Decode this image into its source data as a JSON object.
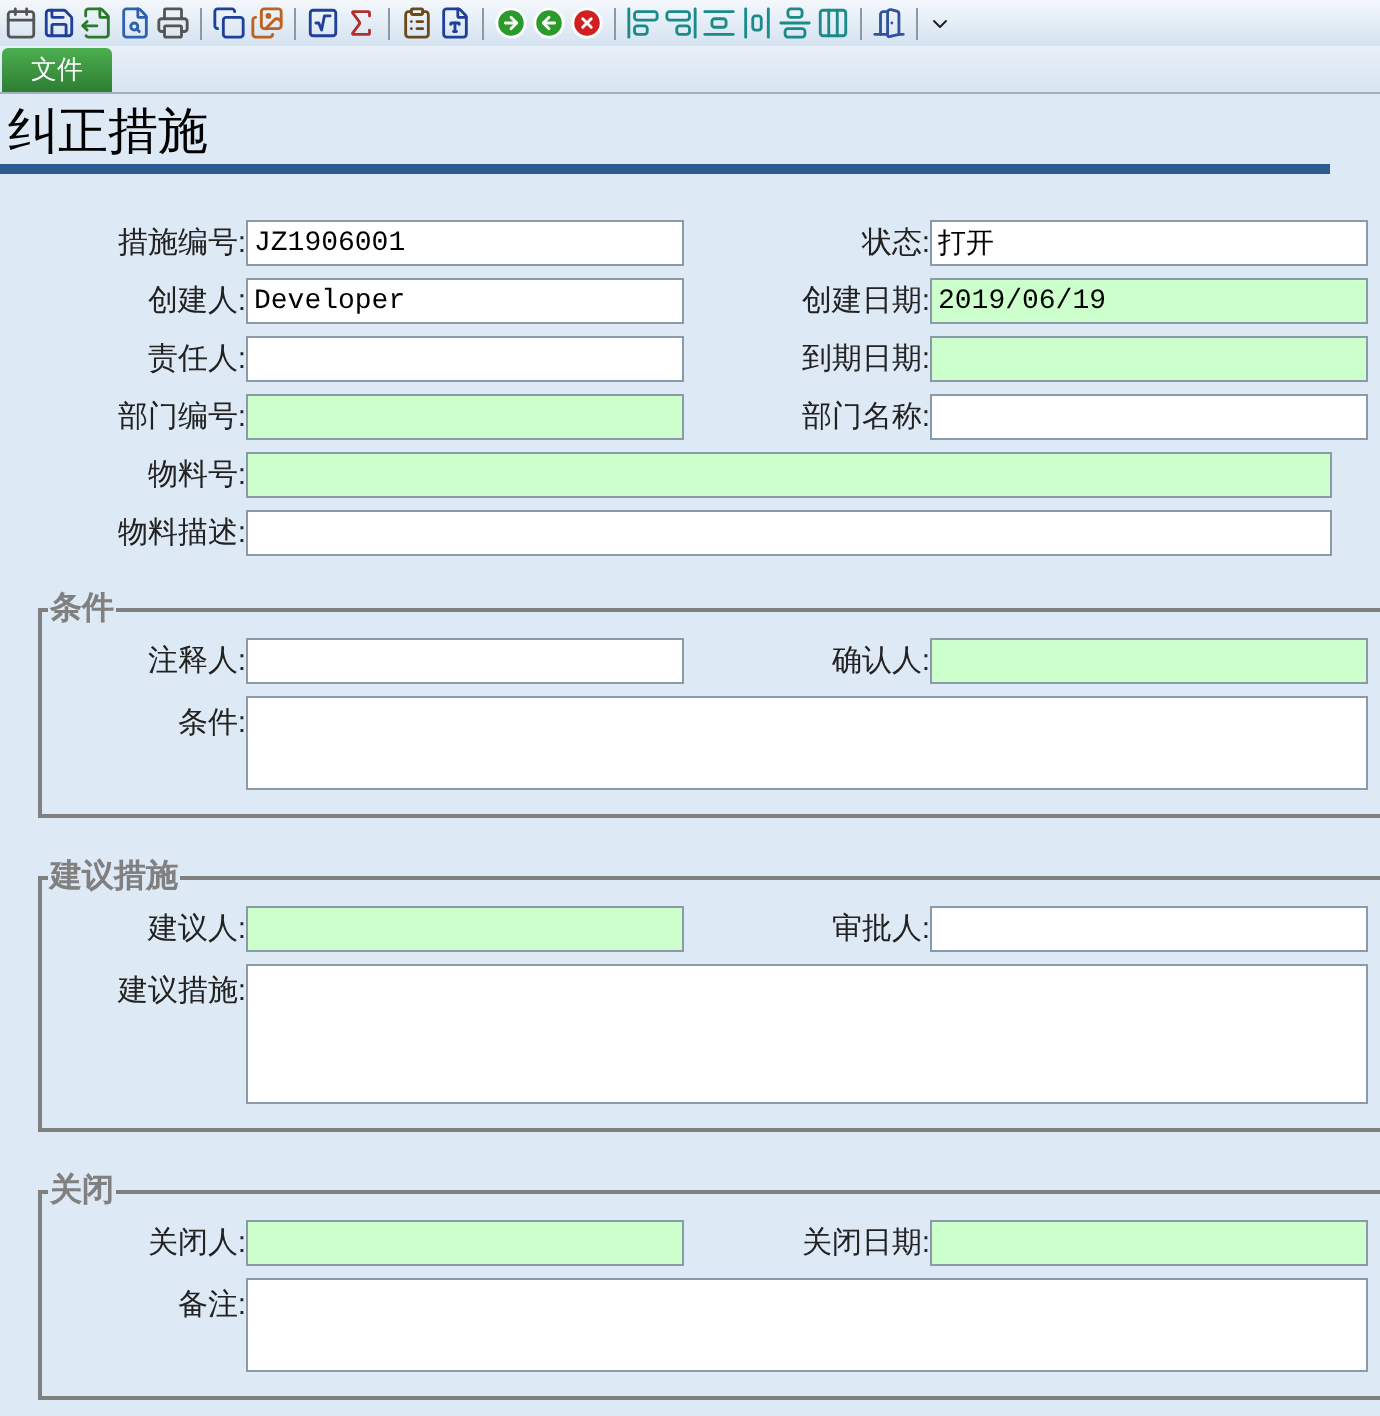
{
  "menu_tabs": [
    {
      "label": "文件",
      "selected": true
    }
  ],
  "title": "纠正措施",
  "main_rows": [
    [
      {
        "label": "措施编号:",
        "value": "JZ1906001",
        "highlighted": false
      },
      {
        "label": "状态:",
        "value": "打开",
        "highlighted": false
      }
    ],
    [
      {
        "label": "创建人:",
        "value": "Developer",
        "highlighted": false
      },
      {
        "label": "创建日期:",
        "value": "2019/06/19",
        "highlighted": true
      }
    ],
    [
      {
        "label": "责任人:",
        "highlighted": false
      },
      {
        "label": "到期日期:",
        "highlighted": true
      }
    ],
    [
      {
        "label": "部门编号:",
        "highlighted": true
      },
      {
        "label": "部门名称:",
        "highlighted": false
      }
    ],
    [
      {
        "label": "物料号:",
        "highlighted": true
      }
    ],
    [
      {
        "label": "物料描述:",
        "highlighted": false
      }
    ]
  ],
  "sections": [
    {
      "title": "条件",
      "rows": [
        [
          {
            "label": "注释人:",
            "highlighted": false
          },
          {
            "label": "确认人:",
            "highlighted": true
          }
        ],
        [
          {
            "label": "条件:",
            "highlighted": false,
            "kind": "textarea"
          }
        ]
      ]
    },
    {
      "title": "建议措施",
      "rows": [
        [
          {
            "label": "建议人:",
            "highlighted": true
          },
          {
            "label": "审批人:",
            "highlighted": false
          }
        ],
        [
          {
            "label": "建议措施:",
            "highlighted": false,
            "kind": "textarea_tall"
          }
        ]
      ]
    },
    {
      "title": "关闭",
      "rows": [
        [
          {
            "label": "关闭人:",
            "highlighted": true
          },
          {
            "label": "关闭日期:",
            "highlighted": true
          }
        ],
        [
          {
            "label": "备注:",
            "highlighted": false,
            "kind": "textarea"
          }
        ]
      ]
    }
  ]
}
